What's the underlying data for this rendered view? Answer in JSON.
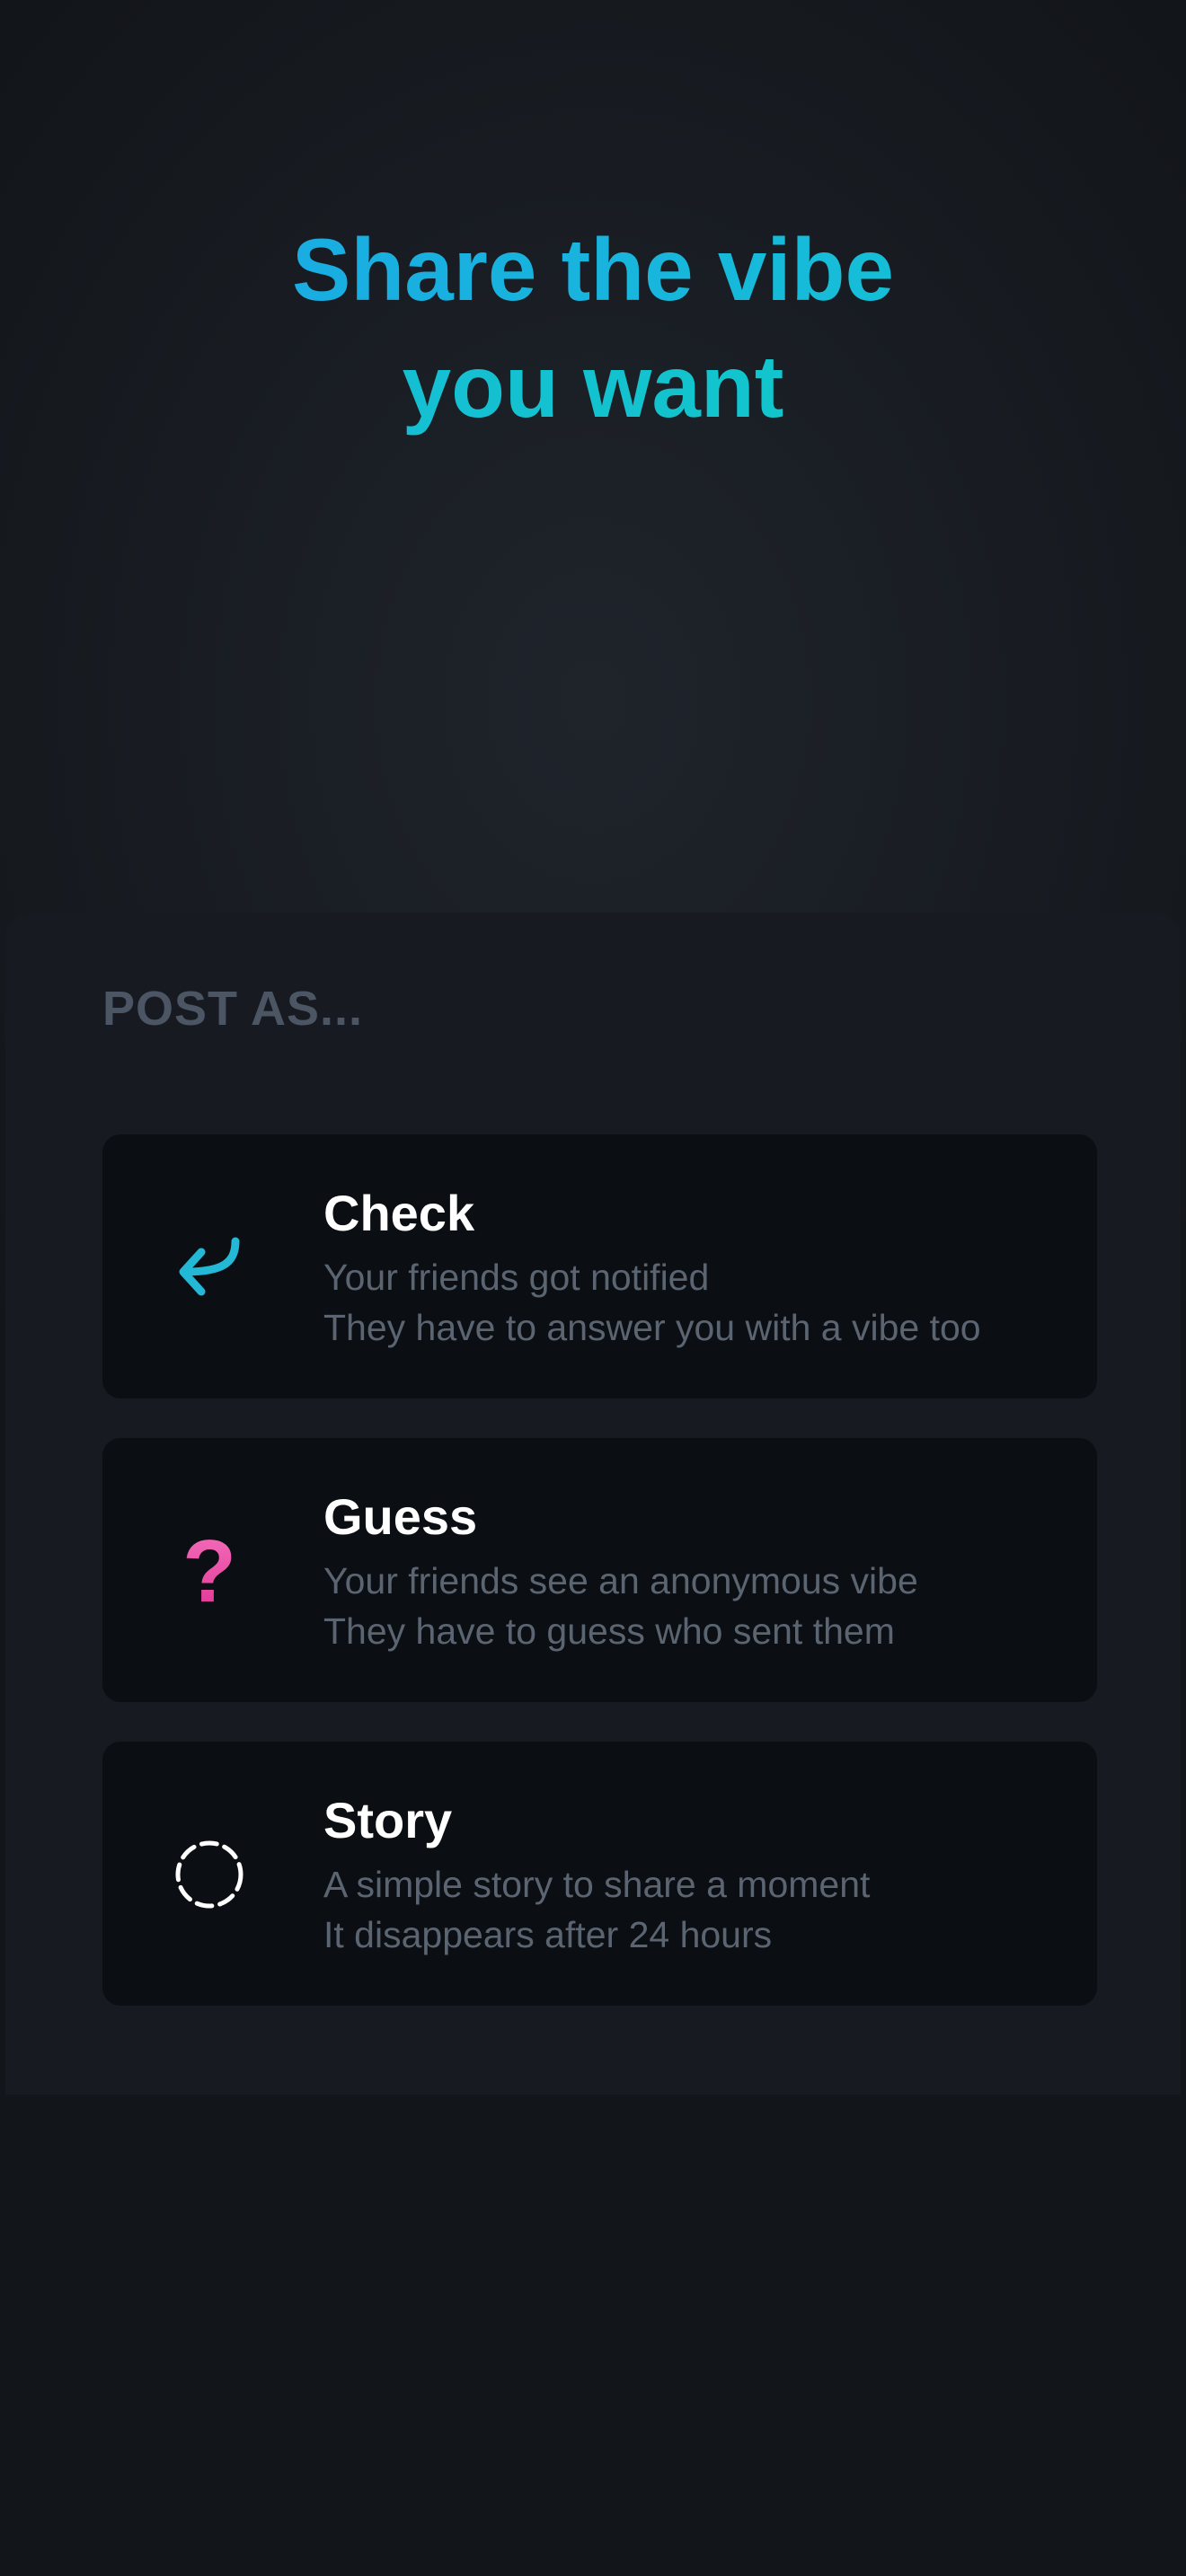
{
  "headline": {
    "line1": "Share the vibe",
    "line2": "you want"
  },
  "sheet": {
    "section_label": "POST AS...",
    "options": [
      {
        "title": "Check",
        "line1": "Your friends got notified",
        "line2": "They have to answer you with a vibe too",
        "icon": "return-arrow-icon",
        "icon_color": "#22b8d6"
      },
      {
        "title": "Guess",
        "line1": "Your friends see an anonymous vibe",
        "line2": "They have to guess who sent them",
        "icon": "question-mark-icon",
        "icon_glyph": "?",
        "icon_color": "#e9479f"
      },
      {
        "title": "Story",
        "line1": "A simple story to share a moment",
        "line2": "It disappears after 24 hours",
        "icon": "dashed-circle-icon",
        "icon_color": "#ffffff"
      }
    ]
  },
  "colors": {
    "background": "#15191f",
    "card_background": "#0b0e12",
    "accent_cyan": "#1aa6e6",
    "accent_teal": "#0fcbc6",
    "muted_text": "#5b6471",
    "label_text": "#4b5563"
  }
}
